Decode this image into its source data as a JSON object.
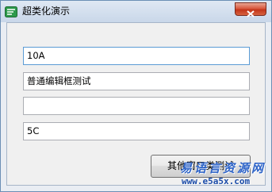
{
  "window": {
    "title": "超类化演示",
    "icon": "app-logo-icon",
    "close_icon": "close-icon"
  },
  "fields": [
    {
      "value": "10A",
      "focused": true
    },
    {
      "value": "普通编辑框测试",
      "focused": false
    },
    {
      "value": "",
      "focused": false
    },
    {
      "value": "5C",
      "focused": false
    }
  ],
  "button": {
    "label": "其他窗口类测试"
  },
  "watermark": {
    "logo_text": "易语言资源网",
    "url": "www.e5a5x.com"
  },
  "colors": {
    "title_bar": "#c9d7e9",
    "close_button": "#c2351a",
    "focus_border": "#5b9bd5",
    "watermark": "#2e64c8"
  }
}
